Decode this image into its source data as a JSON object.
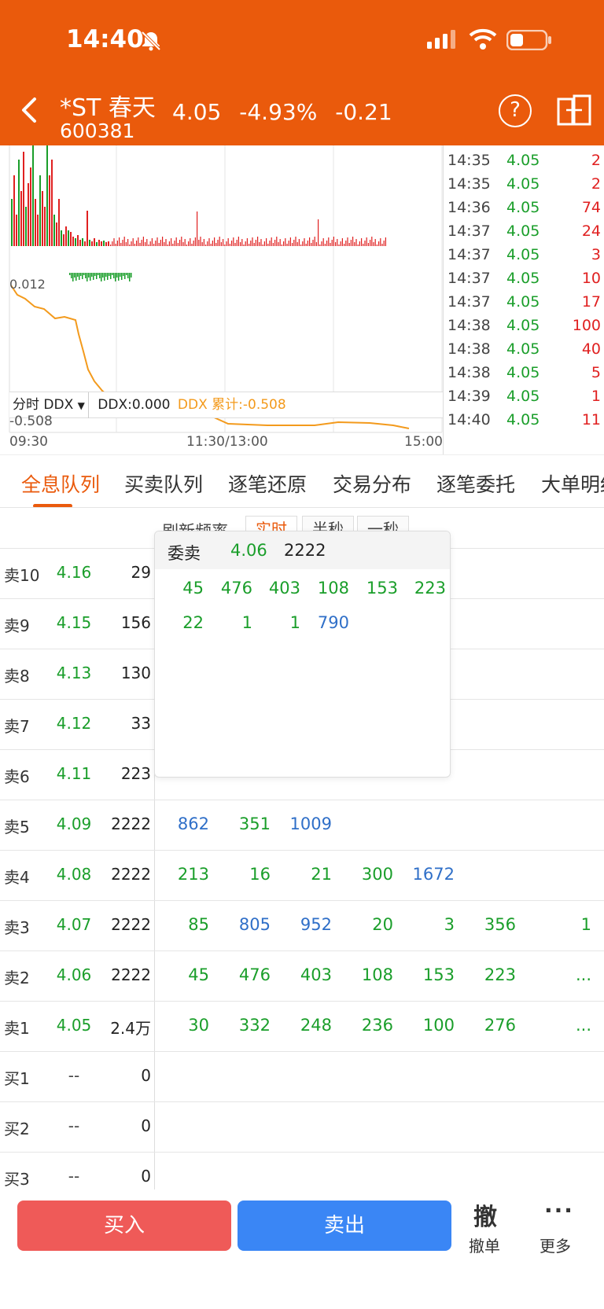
{
  "status_bar": {
    "time": "14:40"
  },
  "header": {
    "stock_name": "*ST 春天",
    "stock_code": "600381",
    "price": "4.05",
    "change_pct": "-4.93%",
    "change": "-0.21",
    "help_symbol": "?"
  },
  "chart": {
    "ddx_selector": "分时 DDX",
    "ddx_value": "DDX:0.000",
    "ddx_cum": "DDX 累计:-0.508",
    "axis_top_label": "0.012",
    "axis_bottom_label": "-0.508",
    "time_start": "09:30",
    "time_mid": "11:30/13:00",
    "time_end": "15:00"
  },
  "ticks": [
    {
      "time": "14:35",
      "price": "4.05",
      "vol": "2"
    },
    {
      "time": "14:35",
      "price": "4.05",
      "vol": "2"
    },
    {
      "time": "14:36",
      "price": "4.05",
      "vol": "74"
    },
    {
      "time": "14:37",
      "price": "4.05",
      "vol": "24"
    },
    {
      "time": "14:37",
      "price": "4.05",
      "vol": "3"
    },
    {
      "time": "14:37",
      "price": "4.05",
      "vol": "10"
    },
    {
      "time": "14:37",
      "price": "4.05",
      "vol": "17"
    },
    {
      "time": "14:38",
      "price": "4.05",
      "vol": "100"
    },
    {
      "time": "14:38",
      "price": "4.05",
      "vol": "40"
    },
    {
      "time": "14:38",
      "price": "4.05",
      "vol": "5"
    },
    {
      "time": "14:39",
      "price": "4.05",
      "vol": "1"
    },
    {
      "time": "14:40",
      "price": "4.05",
      "vol": "11"
    }
  ],
  "tabs": [
    "全息队列",
    "买卖队列",
    "逐笔还原",
    "交易分布",
    "逐笔委托",
    "大单明细"
  ],
  "freq": {
    "label": "刷新频率",
    "options": [
      "实时",
      "半秒",
      "一秒"
    ]
  },
  "book": [
    {
      "level": "卖10",
      "price": "4.16",
      "vol": "29",
      "queue": []
    },
    {
      "level": "卖9",
      "price": "4.15",
      "vol": "156",
      "queue": []
    },
    {
      "level": "卖8",
      "price": "4.13",
      "vol": "130",
      "queue": []
    },
    {
      "level": "卖7",
      "price": "4.12",
      "vol": "33",
      "queue": []
    },
    {
      "level": "卖6",
      "price": "4.11",
      "vol": "223",
      "queue": []
    },
    {
      "level": "卖5",
      "price": "4.09",
      "vol": "2222",
      "queue": [
        [
          "862",
          "b"
        ],
        [
          "351",
          "g"
        ],
        [
          "1009",
          "b"
        ]
      ]
    },
    {
      "level": "卖4",
      "price": "4.08",
      "vol": "2222",
      "queue": [
        [
          "213",
          "g"
        ],
        [
          "16",
          "g"
        ],
        [
          "21",
          "g"
        ],
        [
          "300",
          "g"
        ],
        [
          "1672",
          "b"
        ]
      ]
    },
    {
      "level": "卖3",
      "price": "4.07",
      "vol": "2222",
      "queue": [
        [
          "85",
          "g"
        ],
        [
          "805",
          "b"
        ],
        [
          "952",
          "b"
        ],
        [
          "20",
          "g"
        ],
        [
          "3",
          "g"
        ],
        [
          "356",
          "g"
        ],
        [
          "1",
          "g"
        ]
      ]
    },
    {
      "level": "卖2",
      "price": "4.06",
      "vol": "2222",
      "queue": [
        [
          "45",
          "g"
        ],
        [
          "476",
          "g"
        ],
        [
          "403",
          "g"
        ],
        [
          "108",
          "g"
        ],
        [
          "153",
          "g"
        ],
        [
          "223",
          "g"
        ],
        [
          "...",
          "g"
        ]
      ]
    },
    {
      "level": "卖1",
      "price": "4.05",
      "vol": "2.4万",
      "queue": [
        [
          "30",
          "g"
        ],
        [
          "332",
          "g"
        ],
        [
          "248",
          "g"
        ],
        [
          "236",
          "g"
        ],
        [
          "100",
          "g"
        ],
        [
          "276",
          "g"
        ],
        [
          "...",
          "g"
        ]
      ]
    },
    {
      "level": "买1",
      "price": "--",
      "vol": "0",
      "queue": []
    },
    {
      "level": "买2",
      "price": "--",
      "vol": "0",
      "queue": []
    },
    {
      "level": "买3",
      "price": "--",
      "vol": "0",
      "queue": []
    }
  ],
  "popup": {
    "label": "委卖",
    "price": "4.06",
    "vol": "2222",
    "row1": [
      [
        "45",
        "g"
      ],
      [
        "476",
        "g"
      ],
      [
        "403",
        "g"
      ],
      [
        "108",
        "g"
      ],
      [
        "153",
        "g"
      ],
      [
        "223",
        "g"
      ]
    ],
    "row2": [
      [
        "22",
        "g"
      ],
      [
        "1",
        "g"
      ],
      [
        "1",
        "g"
      ],
      [
        "790",
        "b"
      ]
    ]
  },
  "bottom": {
    "buy": "买入",
    "sell": "卖出",
    "cancel_icon": "撤",
    "cancel": "撤单",
    "more_icon": "···",
    "more": "更多"
  },
  "colors": {
    "accent": "#ea5a0c",
    "up": "#e02020",
    "down": "#1a9e2a",
    "blue": "#2f6fc8",
    "buy": "#ef5a58",
    "sell": "#3a86f5"
  }
}
